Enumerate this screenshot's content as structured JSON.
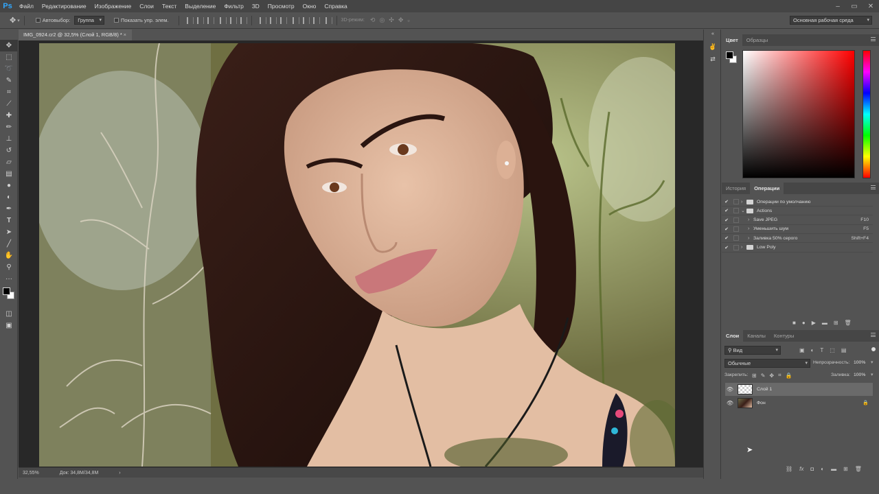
{
  "app": {
    "logo": "Ps"
  },
  "menu": [
    "Файл",
    "Редактирование",
    "Изображение",
    "Слои",
    "Текст",
    "Выделение",
    "Фильтр",
    "3D",
    "Просмотр",
    "Окно",
    "Справка"
  ],
  "options": {
    "autoselect_label": "Автовыбор:",
    "autoselect_value": "Группа",
    "show_transform_label": "Показать упр. элем.",
    "mode_3d_label": "3D-режим:",
    "workspace": "Основная рабочая среда"
  },
  "document": {
    "tab_title": "IMG_0924.cr2 @ 32,5% (Слой 1, RGB/8) *",
    "zoom": "32,55%",
    "doc_size": "Док: 34,8M/34,8M"
  },
  "color_panel": {
    "tabs": [
      "Цвет",
      "Образцы"
    ],
    "active": "Цвет",
    "accent": "#ff0000"
  },
  "actions_panel": {
    "tabs": [
      "История",
      "Операции"
    ],
    "active": "Операции",
    "rows": [
      {
        "label": "Операции по умолчанию",
        "type": "set",
        "expanded": false,
        "indent": 0,
        "key": ""
      },
      {
        "label": "Actions",
        "type": "set",
        "expanded": true,
        "indent": 0,
        "key": ""
      },
      {
        "label": "Save JPEG",
        "type": "action",
        "indent": 1,
        "key": "F10"
      },
      {
        "label": "Уменьшить шум",
        "type": "action",
        "indent": 1,
        "key": "F5"
      },
      {
        "label": "Заливка 50% серого",
        "type": "action",
        "indent": 1,
        "key": "Shift+F4"
      },
      {
        "label": "Low Poly",
        "type": "set",
        "expanded": false,
        "indent": 0,
        "key": ""
      }
    ]
  },
  "layers_panel": {
    "tabs": [
      "Слои",
      "Каналы",
      "Контуры"
    ],
    "active": "Слои",
    "filter": "Вид",
    "blend_mode": "Обычные",
    "opacity_label": "Непрозрачность:",
    "opacity": "100%",
    "lock_label": "Закрепить:",
    "fill_label": "Заливка:",
    "fill": "100%",
    "layers": [
      {
        "name": "Слой 1",
        "selected": true,
        "locked": false
      },
      {
        "name": "Фон",
        "selected": false,
        "locked": true
      }
    ]
  }
}
